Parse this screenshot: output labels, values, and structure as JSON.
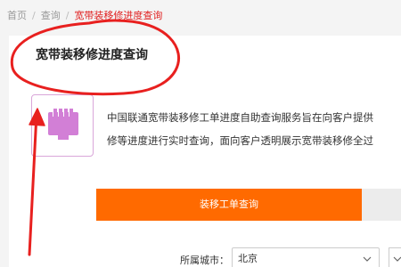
{
  "breadcrumb": {
    "home": "首页",
    "query": "查询",
    "current": "宽带装移修进度查询",
    "separator": "/"
  },
  "page": {
    "title": "宽带装移修进度查询"
  },
  "service": {
    "icon": "network-port-icon",
    "description_line1": "中国联通宽带装移修工单进度自助查询服务旨在向客户提供",
    "description_line2": "修等进度进行实时查询，面向客户透明展示宽带装移修全过"
  },
  "tabs": {
    "active_label": "装移工单查询"
  },
  "form": {
    "city_label": "所属城市：",
    "city_value": "北京"
  },
  "colors": {
    "accent": "#ff6a00",
    "breadcrumb_active": "#e02020",
    "annotation": "#e8201f",
    "icon": "#d27fd6"
  }
}
